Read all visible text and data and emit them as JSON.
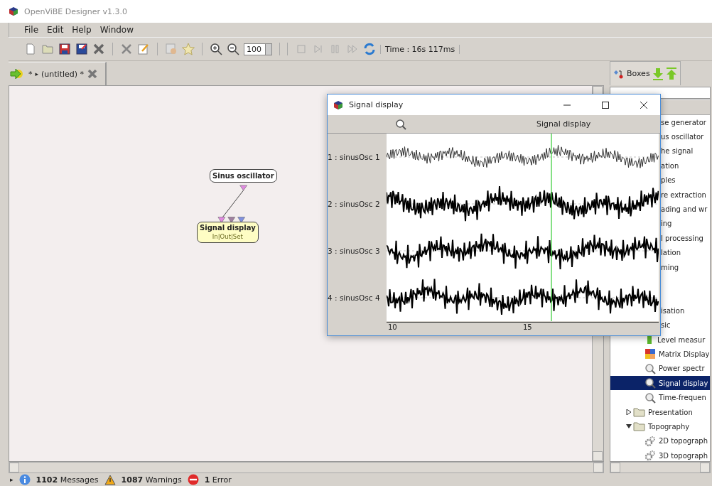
{
  "window": {
    "title": "OpenViBE Designer v1.3.0"
  },
  "menu": [
    {
      "label": "File"
    },
    {
      "label": "Edit"
    },
    {
      "label": "Help"
    },
    {
      "label": "Window"
    }
  ],
  "toolbar": {
    "zoom_value": "100",
    "time": "Time : 16s 117ms"
  },
  "scenario_tab": {
    "marker": "*",
    "expander": "▸",
    "label": "(untitled) *",
    "selected": true
  },
  "canvas": {
    "boxes": [
      {
        "title": "Sinus oscillator",
        "kind": "source"
      },
      {
        "title": "Signal display",
        "subtitle": "In|Out|Set",
        "kind": "sink"
      }
    ]
  },
  "boxes_panel": {
    "tab": "Boxes",
    "tree": [
      {
        "label": "se generator",
        "kind": "partial"
      },
      {
        "label": "us oscillator",
        "kind": "partial"
      },
      {
        "label": "he signal",
        "kind": "partial"
      },
      {
        "label": "ation",
        "kind": "partial"
      },
      {
        "label": "ples",
        "kind": "partial"
      },
      {
        "label": "re extraction",
        "kind": "partial"
      },
      {
        "label": "ading and wr",
        "kind": "partial"
      },
      {
        "label": "ing",
        "kind": "partial"
      },
      {
        "label": "l processing",
        "kind": "partial"
      },
      {
        "label": "lation",
        "kind": "partial"
      },
      {
        "label": "ming",
        "kind": "partial"
      },
      {
        "label": "isation",
        "kind": "partial",
        "children": [
          {
            "label": "sic",
            "kind": "partial",
            "children": [
              {
                "label": "Level measur",
                "kind": "meter",
                "selected": false
              },
              {
                "label": "Matrix Display",
                "kind": "matrix",
                "selected": false
              },
              {
                "label": "Power spectr",
                "kind": "scope",
                "selected": false
              },
              {
                "label": "Signal display",
                "kind": "scope",
                "selected": true
              },
              {
                "label": "Time-frequen",
                "kind": "scope",
                "selected": false
              }
            ]
          },
          {
            "label": "Presentation",
            "kind": "folder",
            "expanded": false
          },
          {
            "label": "Topography",
            "kind": "folder",
            "expanded": true,
            "children": [
              {
                "label": "2D topograph",
                "kind": "gear",
                "selected": false
              },
              {
                "label": "3D topograph",
                "kind": "gear",
                "selected": false
              }
            ]
          }
        ]
      }
    ]
  },
  "signal_window": {
    "title": "Signal display",
    "header": "Signal display",
    "channels": [
      {
        "name": "1 : sinusOsc 1"
      },
      {
        "name": "2 : sinusOsc 2"
      },
      {
        "name": "3 : sinusOsc 3"
      },
      {
        "name": "4 : sinusOsc 4"
      }
    ],
    "time_ticks": [
      "10",
      "15"
    ]
  },
  "status_bar": {
    "expander": "▸",
    "messages": "**1102** Messages",
    "warnings": "**1087** Warnings",
    "errors": "**1** Error"
  }
}
